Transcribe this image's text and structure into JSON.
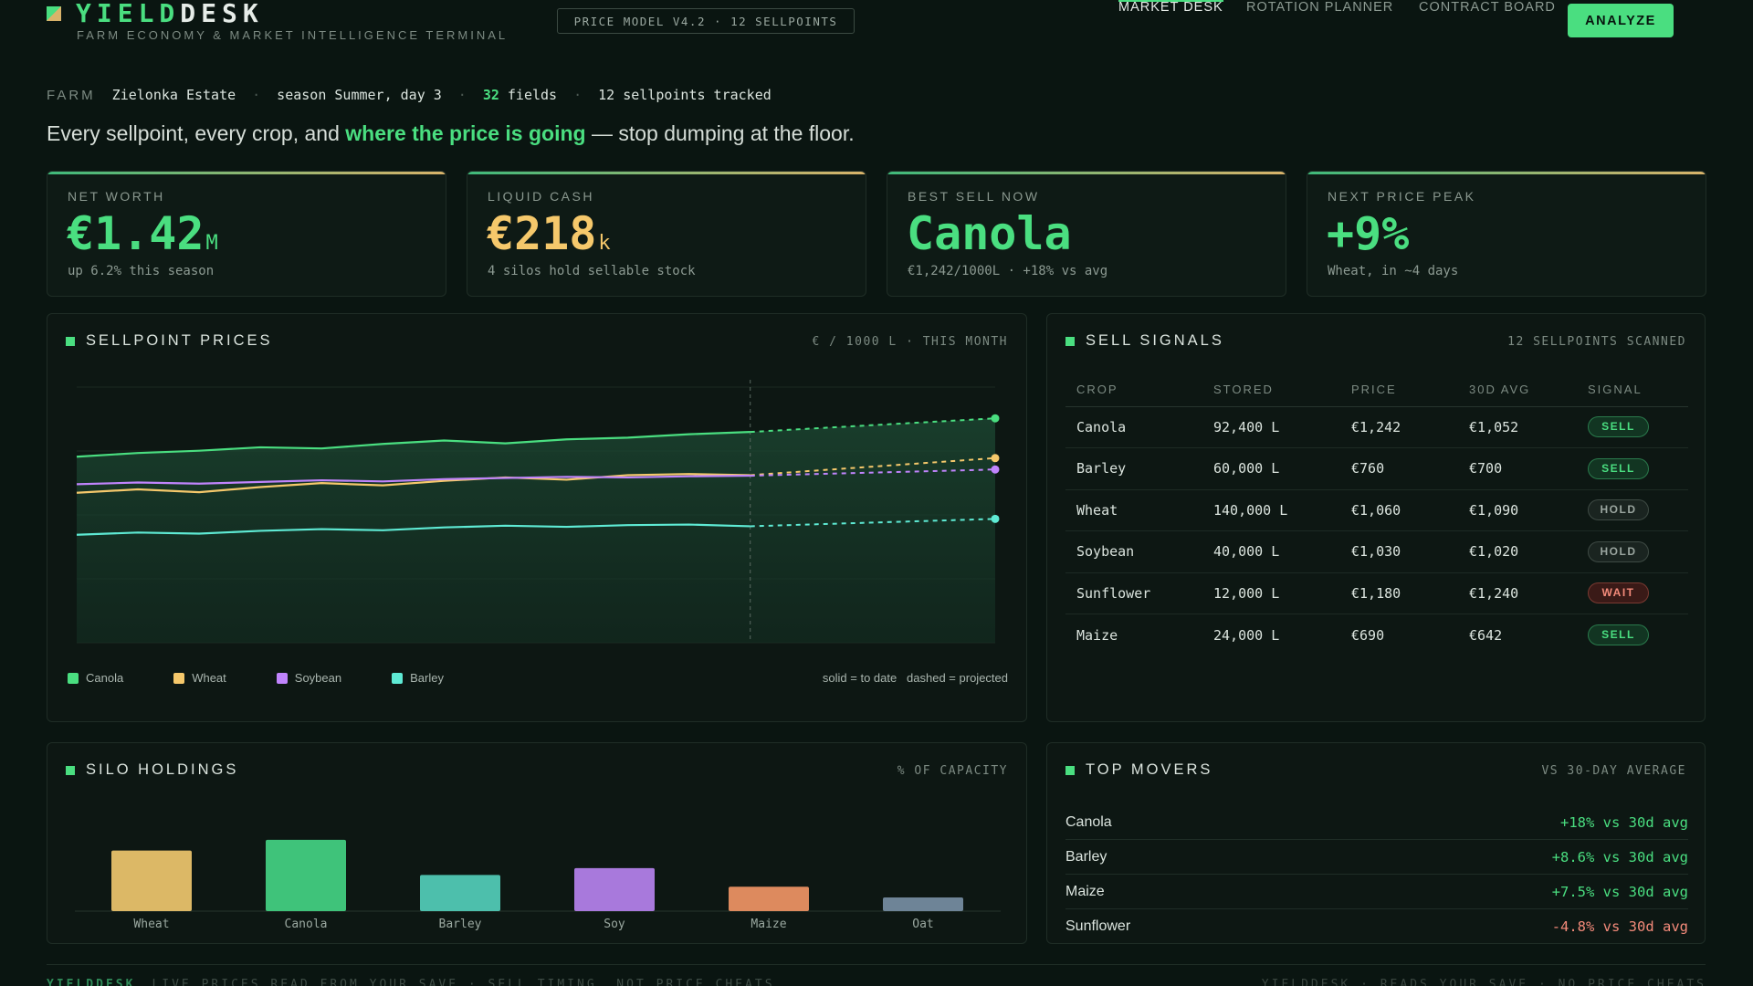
{
  "brand": {
    "name_part1": "YIELD",
    "name_part2": "DESK",
    "subtitle": "FARM ECONOMY & MARKET INTELLIGENCE TERMINAL",
    "model_pill": "PRICE MODEL V4.2 · 12 SELLPOINTS"
  },
  "nav": {
    "items": [
      "MARKET DESK",
      "ROTATION PLANNER",
      "CONTRACT BOARD"
    ],
    "active": "MARKET DESK",
    "analyze_label": "ANALYZE"
  },
  "farm": {
    "label": "FARM",
    "name": "Zielonka Estate",
    "season": "season Summer, day 3",
    "fields_count": "32",
    "fields_word": "fields",
    "sellpoints": "12 sellpoints tracked",
    "separator": "·"
  },
  "tagline": {
    "pre": "Every sellpoint, every crop, and ",
    "accent": "where the price is going",
    "post": " — stop dumping at the floor."
  },
  "stats": [
    {
      "label": "NET WORTH",
      "value": "€1.42",
      "unit": "M",
      "sub": "up 6.2% this season",
      "color": "#4ade80"
    },
    {
      "label": "LIQUID CASH",
      "value": "€218",
      "unit": "k",
      "sub": "4 silos hold sellable stock",
      "color": "#f5c86b"
    },
    {
      "label": "BEST SELL NOW",
      "value": "Canola",
      "unit": "",
      "sub": "€1,242/1000L · +18% vs avg",
      "color": "#4ade80"
    },
    {
      "label": "NEXT PRICE PEAK",
      "value": "+9%",
      "unit": "",
      "sub": "Wheat, in ~4 days",
      "color": "#4ade80"
    }
  ],
  "sellpoint_panel": {
    "title": "SELLPOINT PRICES",
    "meta": "€ / 1000 L · THIS MONTH",
    "legend_note": "solid = to date   dashed = projected"
  },
  "chart_data": {
    "type": "line",
    "title": "SELLPOINT PRICES",
    "ylabel": "€ / 1000 L",
    "xlabel": "",
    "x": [
      1,
      2,
      3,
      4,
      5,
      6,
      7,
      8,
      9,
      10,
      11,
      12
    ],
    "ylim": [
      500,
      1400
    ],
    "projection_x": 16,
    "grid": true,
    "legend_placement": "bottom-left",
    "series": [
      {
        "name": "Canola",
        "color": "#4ade80",
        "values": [
          1155,
          1168,
          1176,
          1188,
          1184,
          1200,
          1212,
          1202,
          1216,
          1222,
          1234,
          1242
        ],
        "projected": 1290
      },
      {
        "name": "Wheat",
        "color": "#f5c86b",
        "values": [
          1028,
          1040,
          1030,
          1048,
          1062,
          1054,
          1070,
          1082,
          1074,
          1090,
          1094,
          1090
        ],
        "projected": 1150
      },
      {
        "name": "Soybean",
        "color": "#c084fc",
        "values": [
          1058,
          1064,
          1060,
          1066,
          1072,
          1068,
          1076,
          1080,
          1084,
          1082,
          1086,
          1088
        ],
        "projected": 1110
      },
      {
        "name": "Barley",
        "color": "#5eead4",
        "values": [
          880,
          888,
          884,
          894,
          900,
          896,
          906,
          912,
          908,
          914,
          916,
          910
        ],
        "projected": 936
      }
    ]
  },
  "signals_panel": {
    "title": "SELL SIGNALS",
    "meta": "12 SELLPOINTS SCANNED",
    "columns": [
      "CROP",
      "STORED",
      "PRICE",
      "30D AVG",
      "SIGNAL"
    ],
    "rows": [
      {
        "crop": "Canola",
        "stored": "92,400 L",
        "price": "€1,242",
        "avg": "€1,052",
        "signal": "SELL",
        "kind": "sell"
      },
      {
        "crop": "Barley",
        "stored": "60,000 L",
        "price": "€760",
        "avg": "€700",
        "signal": "SELL",
        "kind": "sell"
      },
      {
        "crop": "Wheat",
        "stored": "140,000 L",
        "price": "€1,060",
        "avg": "€1,090",
        "signal": "HOLD",
        "kind": "hold"
      },
      {
        "crop": "Soybean",
        "stored": "40,000 L",
        "price": "€1,030",
        "avg": "€1,020",
        "signal": "HOLD",
        "kind": "hold"
      },
      {
        "crop": "Sunflower",
        "stored": "12,000 L",
        "price": "€1,180",
        "avg": "€1,240",
        "signal": "WAIT",
        "kind": "wait"
      },
      {
        "crop": "Maize",
        "stored": "24,000 L",
        "price": "€690",
        "avg": "€642",
        "signal": "SELL",
        "kind": "sell"
      }
    ]
  },
  "silo_panel": {
    "title": "SILO HOLDINGS",
    "meta": "% OF CAPACITY",
    "bars": [
      {
        "label": "Wheat",
        "value": 62,
        "color": "#dcb866"
      },
      {
        "label": "Canola",
        "value": 73,
        "color": "#3fc37a"
      },
      {
        "label": "Barley",
        "value": 37,
        "color": "#4dbfac"
      },
      {
        "label": "Soy",
        "value": 44,
        "color": "#a879dc"
      },
      {
        "label": "Maize",
        "value": 25,
        "color": "#dd8a5e"
      },
      {
        "label": "Oat",
        "value": 14,
        "color": "#6e8497"
      }
    ]
  },
  "movers_panel": {
    "title": "TOP MOVERS",
    "meta": "VS 30-DAY AVERAGE",
    "items": [
      {
        "name": "Canola",
        "value": "+18% vs 30d avg",
        "dir": "up"
      },
      {
        "name": "Barley",
        "value": "+8.6% vs 30d avg",
        "dir": "up"
      },
      {
        "name": "Maize",
        "value": "+7.5% vs 30d avg",
        "dir": "up"
      },
      {
        "name": "Sunflower",
        "value": "-4.8% vs 30d avg",
        "dir": "down"
      }
    ]
  },
  "footer": {
    "brand": "YIELDDESK",
    "text": "LIVE PRICES READ FROM YOUR SAVE · SELL TIMING, NOT PRICE CHEATS",
    "right": "YIELDDESK · READS YOUR SAVE · NO PRICE CHEATS"
  }
}
